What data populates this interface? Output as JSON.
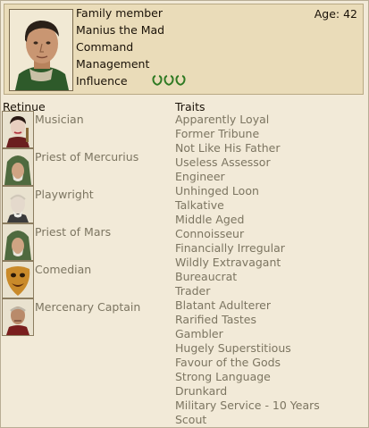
{
  "character": {
    "role": "Family member",
    "name": "Manius the Mad",
    "age": "Age: 42",
    "stats": {
      "command": "Command",
      "management": "Management",
      "influence": "Influence",
      "influence_level": 3
    }
  },
  "retinue": {
    "title": "Retinue",
    "items": [
      {
        "name": "Musician",
        "icon": "musician-portrait-icon"
      },
      {
        "name": "Priest of Mercurius",
        "icon": "priest-portrait-icon"
      },
      {
        "name": "Playwright",
        "icon": "playwright-portrait-icon"
      },
      {
        "name": "Priest of Mars",
        "icon": "priest-portrait-icon"
      },
      {
        "name": "Comedian",
        "icon": "comedian-mask-icon"
      },
      {
        "name": "Mercenary Captain",
        "icon": "captain-portrait-icon"
      }
    ]
  },
  "traits": {
    "title": "Traits",
    "items": [
      "Apparently Loyal",
      "Former Tribune",
      "Not Like His Father",
      "Useless Assessor",
      "Engineer",
      "Unhinged Loon",
      "Talkative",
      "Middle Aged",
      "Connoisseur",
      "Financially Irregular",
      "Wildly Extravagant",
      "Bureaucrat",
      "Trader",
      "Blatant Adulterer",
      "Rarified Tastes",
      "Gambler",
      "Hugely Superstitious",
      "Favour of the Gods",
      "Strong Language",
      "Drunkard",
      "Military Service - 10 Years",
      "Scout"
    ]
  },
  "colors": {
    "panel_bg": "#f2ead8",
    "header_bg": "#eadcb9",
    "dim_text": "#7c7561",
    "laurel_green": "#2f7a23"
  }
}
